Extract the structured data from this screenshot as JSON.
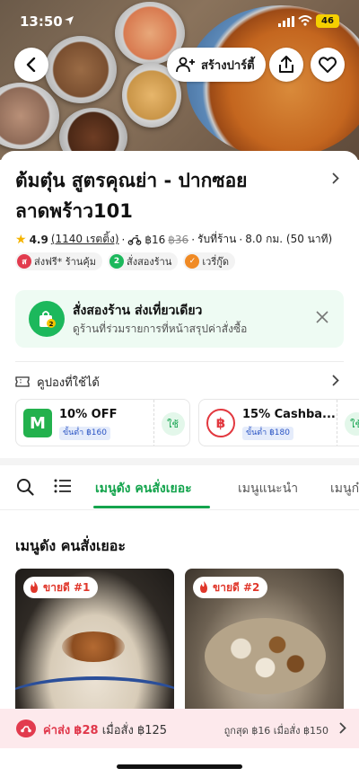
{
  "status_bar": {
    "time": "13:50",
    "battery": "46"
  },
  "header": {
    "party_button": "สร้างปาร์ตี้"
  },
  "restaurant": {
    "name": "ต้มตุ๋น สูตรคุณย่า - ปากซอยลาดพร้าว101",
    "rating": "4.9",
    "rating_count": "(1140 เรตติ้ง)",
    "delivery_fee": "฿16",
    "delivery_fee_old": "฿36",
    "pickup": "รับที่ร้าน",
    "distance": "8.0 กม. (50 นาที)",
    "tags": [
      {
        "label": "ส่งฟรี* ร้านคุ้ม",
        "icon": "free-delivery-icon",
        "color": "#e23b4e"
      },
      {
        "label": "สั่งสองร้าน",
        "icon": "two-store-icon",
        "color": "#1cb85c"
      },
      {
        "label": "เวรี่กู๊ด",
        "icon": "very-good-icon",
        "color": "#f08a24"
      }
    ]
  },
  "promo": {
    "title": "สั่งสองร้าน ส่งเที่ยวเดียว",
    "subtitle": "ดูร้านที่ร่วมรายการที่หน้าสรุปค่าสั่งซื้อ"
  },
  "coupons": {
    "header": "คูปองที่ใช้ได้",
    "items": [
      {
        "title": "10% OFF",
        "min": "ขั้นต่ำ ฿160",
        "use": "ใช้",
        "color": "#23b14d",
        "logo": "M"
      },
      {
        "title": "15% Cashba...",
        "min": "ขั้นต่ำ ฿180",
        "use": "ใช้",
        "color": "#e2383f",
        "logo": "฿"
      }
    ]
  },
  "tabs": {
    "items": [
      "เมนูดัง คนสั่งเยอะ",
      "เมนูแนะนำ",
      "เมนูก๋"
    ],
    "active": 0
  },
  "section": {
    "title": "เมนูดัง คนสั่งเยอะ"
  },
  "menu_cards": [
    {
      "badge": "ขายดี #1"
    },
    {
      "badge": "ขายดี #2"
    }
  ],
  "fee_bar": {
    "label": "ค่าส่ง",
    "fee": "฿28",
    "condition": "เมื่อสั่ง ฿125",
    "right": "ถูกสุด ฿16 เมื่อสั่ง ฿150"
  },
  "colors": {
    "brand_green": "#14a44d",
    "fee_red": "#e0374a"
  }
}
